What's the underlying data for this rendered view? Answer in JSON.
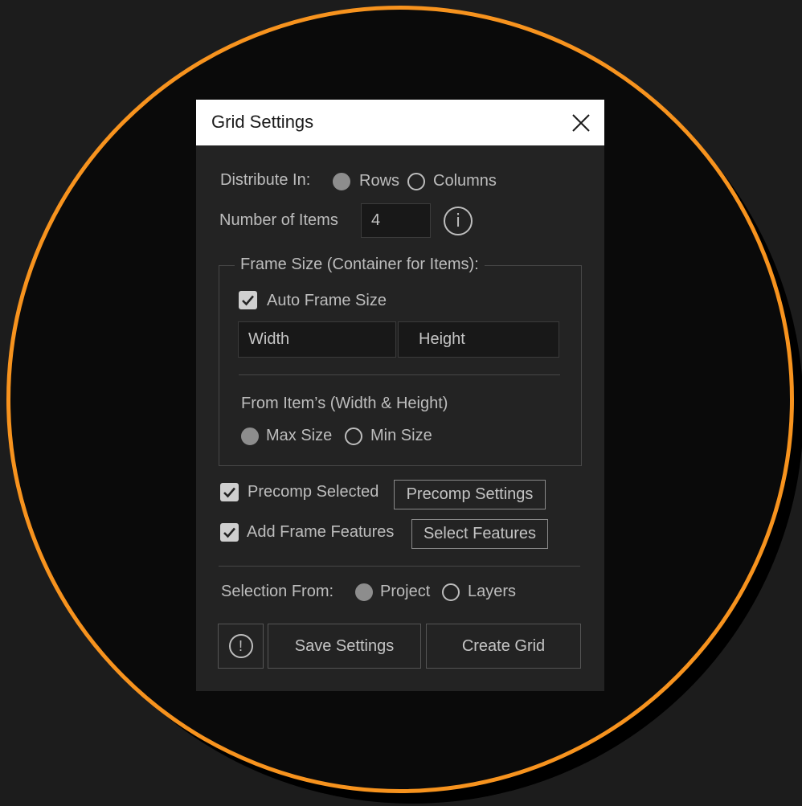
{
  "dialog": {
    "title": "Grid Settings",
    "close_icon": "close-icon"
  },
  "distribute": {
    "label": "Distribute In:",
    "options": [
      "Rows",
      "Columns"
    ],
    "selected": "Rows"
  },
  "items": {
    "label": "Number of Items",
    "value": "4",
    "info_icon": "info-icon",
    "info_glyph": "i"
  },
  "frame": {
    "legend": "Frame Size (Container for Items):",
    "auto_label": "Auto Frame Size",
    "auto_checked": true,
    "width_text": "Width",
    "height_text": "Height",
    "from_label": "From Item’s (Width & Height)",
    "size_options": [
      "Max Size",
      "Min Size"
    ],
    "size_selected": "Max Size"
  },
  "precomp": {
    "label": "Precomp Selected",
    "checked": true,
    "button": "Precomp Settings"
  },
  "features": {
    "label": "Add Frame Features",
    "checked": true,
    "button": "Select Features"
  },
  "selection": {
    "label": "Selection From:",
    "options": [
      "Project",
      "Layers"
    ],
    "selected": "Project"
  },
  "footer": {
    "alert_icon": "alert-icon",
    "alert_glyph": "!",
    "save": "Save Settings",
    "create": "Create Grid"
  },
  "colors": {
    "accent_ring": "#f7931e",
    "panel": "#232323",
    "titlebar": "#ffffff"
  }
}
